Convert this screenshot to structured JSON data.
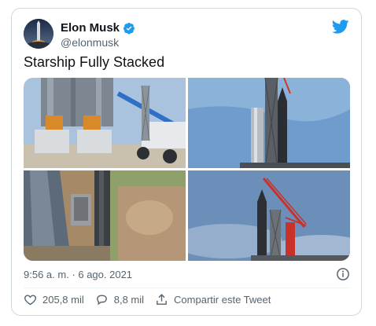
{
  "tweet": {
    "author_name": "Elon Musk",
    "handle": "@elonmusk",
    "text": "Starship Fully Stacked",
    "timestamp": "9:56 a. m. · 6 ago. 2021",
    "likes": "205,8 mil",
    "replies": "8,8 mil",
    "share_label": "Compartir este Tweet"
  },
  "icons": {
    "verified": "verified-badge-icon",
    "brand": "twitter-bird-icon",
    "info": "info-icon",
    "like": "heart-icon",
    "reply": "reply-bubble-icon",
    "share": "share-icon"
  },
  "colors": {
    "brand": "#1d9bf0",
    "text": "#0f1419",
    "secondary": "#536471",
    "border": "#cfd9de"
  }
}
